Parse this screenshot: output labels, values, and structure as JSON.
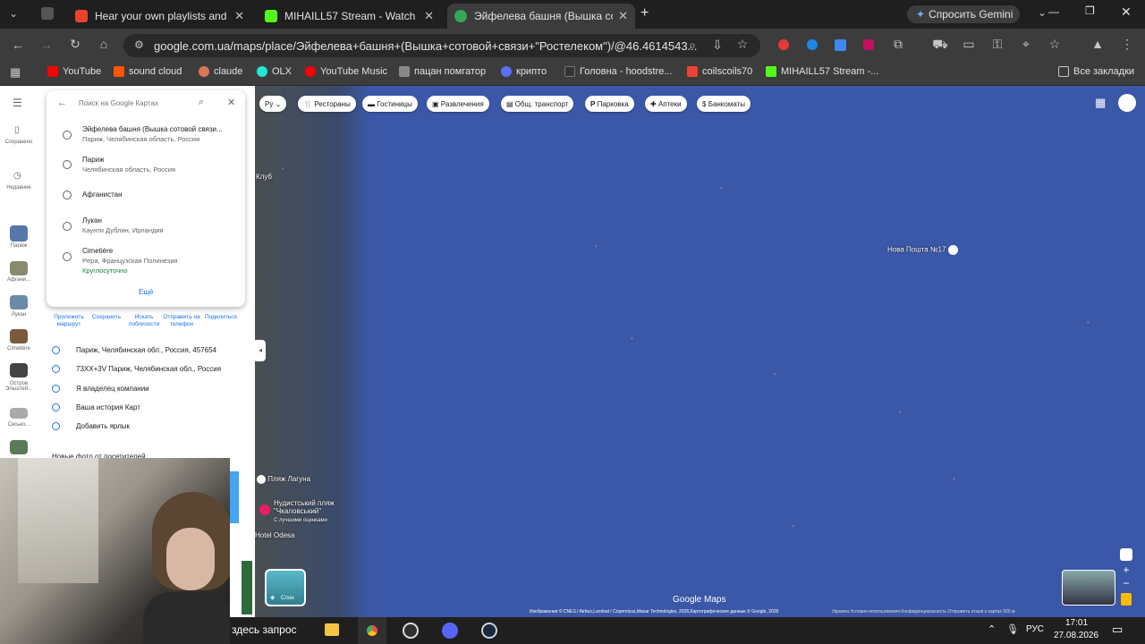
{
  "tabs": [
    {
      "title": "Hear your own playlists and the",
      "color": "#e8452c"
    },
    {
      "title": "MIHAILL57 Stream - Watch Live",
      "color": "#53fc18"
    },
    {
      "title": "Эйфелева башня (Вышка сото",
      "color": "#34a853"
    }
  ],
  "gemini_label": "Спросить Gemini",
  "url": "google.com.ua/maps/place/Эйфелева+башня+(Вышка+сотовой+связи+\"Ростелеком\")/@46.4614543...",
  "bookmarks": [
    {
      "label": "YouTube",
      "color": "#ff0000"
    },
    {
      "label": "sound cloud",
      "color": "#ff5500"
    },
    {
      "label": "claude",
      "color": "#d97757"
    },
    {
      "label": "OLX",
      "color": "#23e5db"
    },
    {
      "label": "YouTube Music",
      "color": "#ff0000"
    },
    {
      "label": "пацан помгатор",
      "color": "#888888"
    },
    {
      "label": "крипто",
      "color": "#5b6ef5"
    },
    {
      "label": "Головна - hoodstre...",
      "color": "#333333"
    },
    {
      "label": "coilscoils70",
      "color": "#ea4335"
    },
    {
      "label": "MIHAILL57 Stream -...",
      "color": "#53fc18"
    }
  ],
  "all_bookmarks": "Все закладки",
  "sidebar": [
    {
      "label": "Сохранено"
    },
    {
      "label": "Недавние"
    },
    {
      "label": "Париж"
    },
    {
      "label": "Афгани..."
    },
    {
      "label": "Лукан"
    },
    {
      "label": "Cimetière"
    },
    {
      "label": "Остров Эльштей..."
    },
    {
      "label": "Сисько..."
    }
  ],
  "search": {
    "placeholder": "Поиск на Google Картах",
    "suggestions": [
      {
        "title": "Эйфелева башня (Вышка сотовой связи...",
        "sub": "Париж, Челябинская область, Россия"
      },
      {
        "title": "Париж",
        "sub": "Челябинская область, Россия"
      },
      {
        "title": "Афганистан",
        "sub": ""
      },
      {
        "title": "Лукан",
        "sub": "Каунти Дублин, Ирландия"
      },
      {
        "title": "Cimetière",
        "sub": "Pepa, Французская Полинезия",
        "extra": "Круглосуточно"
      }
    ],
    "more": "Ещё"
  },
  "actions": [
    "Проложить маршрут",
    "Сохранить",
    "Искать поблизости",
    "Отправить на телефон",
    "Поделиться"
  ],
  "info_rows": [
    "Париж, Челябинская обл., Россия, 457654",
    "73XX+3V Париж, Челябинская обл., Россия",
    "Я владелец компании",
    "Ваша история Карт",
    "Добавить ярлык"
  ],
  "photos_header": "Новые фото от посетителей",
  "chips": [
    "Рестораны",
    "Гостиницы",
    "Развлечения",
    "Общ. транспорт",
    "Парковка",
    "Аптеки",
    "Банкоматы"
  ],
  "chip_lang": "Ру",
  "map_labels": {
    "nova_poshta": "Нова Пошта №17",
    "club": "Клуб",
    "beach": "Пляж Лагуна",
    "nudist": "Нудистський пляж \"Чкаловський\"",
    "nudist_sub": "С лучшими оценками",
    "hotel": "Hotel Odesa",
    "layers": "Слои",
    "google_maps": "Google Maps",
    "attribution": "Изображения © CNES / Airbus,Landsat / Copernicus,Maxar Technologies, 2026,Картографические данные © Google, 2026",
    "footer": "Украина   Условия использования   Конфиденциальность   Отправить отзыв о картах   500 м"
  },
  "taskbar": {
    "search_text": "здесь запрос",
    "lang": "РУС",
    "time": "17:01",
    "date": "27.08.2026"
  }
}
